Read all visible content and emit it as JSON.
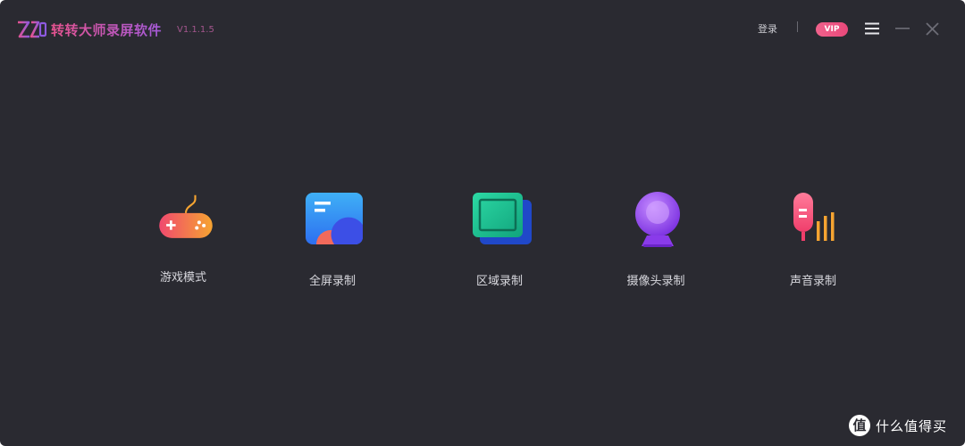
{
  "titlebar": {
    "app_name": "转转大师录屏软件",
    "version": "V1.1.1.5",
    "login_label": "登录",
    "vip_label": "VIP"
  },
  "features": [
    {
      "label": "游戏模式",
      "icon": "gamepad-icon"
    },
    {
      "label": "全屏录制",
      "icon": "fullscreen-record-icon"
    },
    {
      "label": "区域录制",
      "icon": "region-record-icon"
    },
    {
      "label": "摄像头录制",
      "icon": "webcam-icon"
    },
    {
      "label": "声音录制",
      "icon": "microphone-icon"
    }
  ],
  "watermark": {
    "glyph": "值",
    "text": "什么值得买"
  },
  "colors": {
    "window_bg": "#2a2a31",
    "accent_pink": "#e6538f",
    "accent_purple": "#a45ad9",
    "label_text": "#d8d8de"
  }
}
